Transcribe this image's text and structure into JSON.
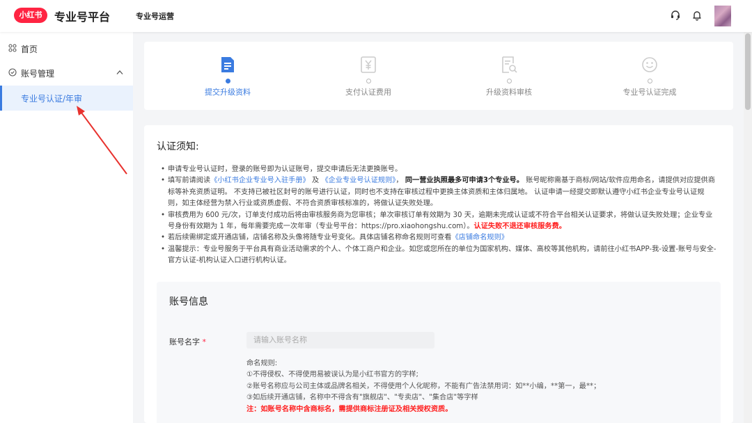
{
  "header": {
    "logo_badge": "小红书",
    "brand": "专业号平台",
    "nav": "专业号运营"
  },
  "sidebar": {
    "items": [
      {
        "label": "首页",
        "icon": "grid-icon"
      },
      {
        "label": "账号管理",
        "icon": "shield-icon",
        "chevron": "^"
      },
      {
        "label": "专业号认证/年审",
        "active": true
      }
    ]
  },
  "steps": [
    {
      "label": "提交升级资料",
      "icon": "document-icon",
      "active": true
    },
    {
      "label": "支付认证费用",
      "icon": "yen-icon",
      "active": false
    },
    {
      "label": "升级资料审核",
      "icon": "search-document-icon",
      "active": false
    },
    {
      "label": "专业号认证完成",
      "icon": "smile-icon",
      "active": false
    }
  ],
  "notice": {
    "title": "认证须知:",
    "items": {
      "i1": "申请专业号认证时，登录的账号即为认证账号，提交申请后无法更换账号。",
      "i2_pre": "填写前请阅读",
      "i2_link1": "《小红书企业专业号入驻手册》",
      "i2_and": "及",
      "i2_link2": "《企业专业号认证规则》",
      "i2_bold": "同一营业执照最多可申请3个专业号。",
      "i2_rest": "账号昵称需基于商标/网站/软件应用命名，请提供对应提供商标等补充资质证明。 不支持已被社区封号的账号进行认证，同时也不支持在审核过程中更换主体资质和主体归属地。 认证申请一经提交即默认遵守小红书企业专业号认证规则，如主体经营为禁入行业或资质虚假、不符合资质审核标准的，将做认证失败处理。",
      "i3": "审核费用为 600 元/次，订单支付成功后将由审核服务商为您审核；单次审核订单有效期为 30 天，逾期未完成认证或不符合平台相关认证要求，将做认证失败处理；企业专业号身份有效期为 1 年，每年需要完成一次年审（专业号平台：https://pro.xiaohongshu.com）。",
      "i3_red": "认证失败不退还审核服务费。",
      "i4_pre": "若后续需绑定或开通店铺，店铺名称及头像将随专业号变化。具体店铺名称命名规则可查看",
      "i4_link": "《店铺命名规则》",
      "i5": "温馨提示：专业号服务于平台具有商业活动需求的个人、个体工商户和企业。如您或您所在的单位为国家机构、媒体、高校等其他机构，请前往小红书APP-我-设置-账号与安全-官方认证-机构认证入口进行机构认证。"
    }
  },
  "account": {
    "title": "账号信息",
    "name_label": "账号名字",
    "required_mark": "*",
    "name_placeholder": "请输入账号名称",
    "rules": {
      "title": "命名规则:",
      "r1": "①不得侵权、不得使用易被误认为是小红书官方的字样;",
      "r2": "②账号名称应与公司主体或品牌名相关，不得使用个人化昵称，不能有广告法禁用词：如**小编，**第一，最**；",
      "r3": "③如后续开通店铺，名称中不得含有\"旗舰店\"、\"专卖店\"、\"集合店\"等字样",
      "note": "注：如账号名称中含商标名，需提供商标注册证及相关授权资质。"
    }
  },
  "colors": {
    "brand_red": "#ff2442",
    "accent_blue": "#3a7be0",
    "warning_red": "#ff1f1f"
  }
}
